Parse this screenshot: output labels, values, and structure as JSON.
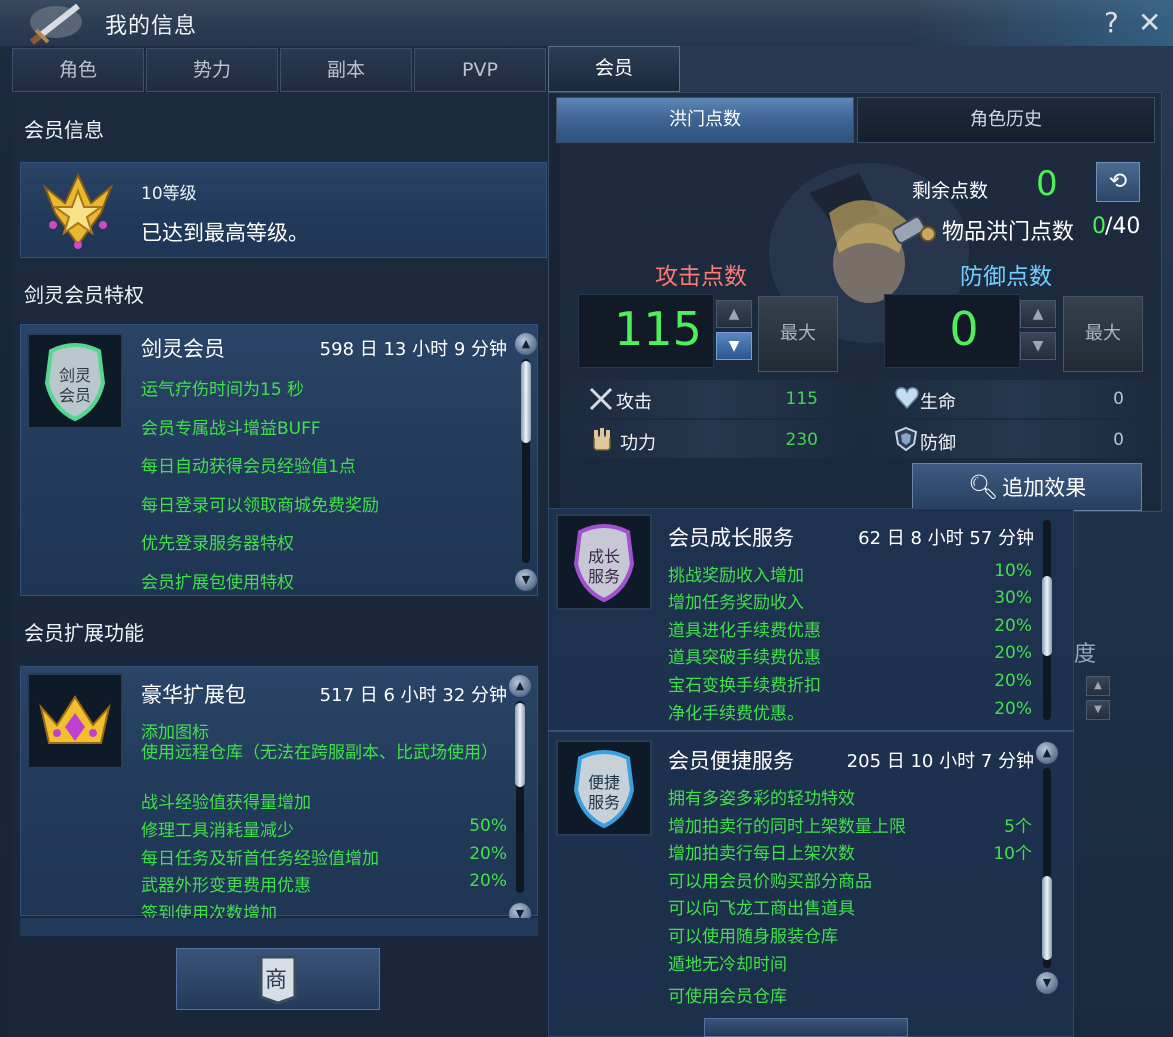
{
  "window": {
    "title": "我的信息",
    "help": "?",
    "close": "✕"
  },
  "tabs": [
    "角色",
    "势力",
    "副本",
    "PVP",
    "会员"
  ],
  "left": {
    "member_info_title": "会员信息",
    "level_text": "10等级",
    "level_desc": "已达到最高等级。",
    "privilege_title": "剑灵会员特权",
    "vip_card": {
      "name": "剑灵会员",
      "time": "598 日 13 小时 9 分钟",
      "perks": [
        "运气疗伤时间为15 秒",
        "会员专属战斗增益BUFF",
        "每日自动获得会员经验值1点",
        "每日登录可以领取商城免费奖励",
        "优先登录服务器特权",
        "会员扩展包使用特权"
      ]
    },
    "ext_title": "会员扩展功能",
    "ext_card": {
      "name": "豪华扩展包",
      "time": "517 日 6 小时 32 分钟",
      "perks": [
        {
          "label": "添加图标",
          "value": ""
        },
        {
          "label": "使用远程仓库（无法在跨服副本、比武场使用）",
          "value": ""
        },
        {
          "label": "战斗经验值获得量增加",
          "value": ""
        },
        {
          "label": "修理工具消耗量减少",
          "value": "50%"
        },
        {
          "label": "每日任务及斩首任务经验值增加",
          "value": "20%"
        },
        {
          "label": "武器外形变更费用优惠",
          "value": "20%"
        },
        {
          "label": "签到使用次数增加",
          "value": ""
        }
      ]
    },
    "shop_icon": "商"
  },
  "right": {
    "subtabs": [
      "洪门点数",
      "角色历史"
    ],
    "remaining_label": "剩余点数",
    "remaining_value": "0",
    "item_points_label": "物品洪门点数",
    "item_points_current": "0",
    "item_points_max": "/40",
    "attack_title": "攻击点数",
    "defense_title": "防御点数",
    "attack_points": "115",
    "defense_points": "0",
    "max_label": "最大",
    "stats": [
      {
        "label": "攻击",
        "value": "115",
        "icon": "crossed-swords-icon"
      },
      {
        "label": "生命",
        "value": "0",
        "icon": "heart-icon"
      },
      {
        "label": "功力",
        "value": "230",
        "icon": "fist-icon"
      },
      {
        "label": "防御",
        "value": "0",
        "icon": "shield-icon"
      }
    ],
    "add_effect_label": "追加效果",
    "growth_card": {
      "name": "会员成长服务",
      "time": "62 日 8 小时 57 分钟",
      "perks": [
        {
          "label": "挑战奖励收入增加",
          "value": "10%"
        },
        {
          "label": "增加任务奖励收入",
          "value": "30%"
        },
        {
          "label": "道具进化手续费优惠",
          "value": "20%"
        },
        {
          "label": "道具突破手续费优惠",
          "value": "20%"
        },
        {
          "label": "宝石变换手续费折扣",
          "value": "20%"
        },
        {
          "label": "净化手续费优惠。",
          "value": "20%"
        }
      ]
    },
    "convenience_card": {
      "name": "会员便捷服务",
      "time": "205 日 10 小时 7 分钟",
      "perks": [
        {
          "label": "拥有多姿多彩的轻功特效",
          "value": ""
        },
        {
          "label": "增加拍卖行的同时上架数量上限",
          "value": "5个"
        },
        {
          "label": "增加拍卖行每日上架次数",
          "value": "10个"
        },
        {
          "label": "可以用会员价购买部分商品",
          "value": ""
        },
        {
          "label": "可以向飞龙工商出售道具",
          "value": ""
        },
        {
          "label": "可以使用随身服装仓库",
          "value": ""
        },
        {
          "label": "遁地无冷却时间",
          "value": ""
        },
        {
          "label": "可使用会员仓库",
          "value": ""
        }
      ]
    },
    "bg_text_fragment": "度"
  },
  "colors": {
    "accent_green": "#41e04a",
    "attack_title": "#ff7a72",
    "defense_title": "#6fd0ff"
  }
}
